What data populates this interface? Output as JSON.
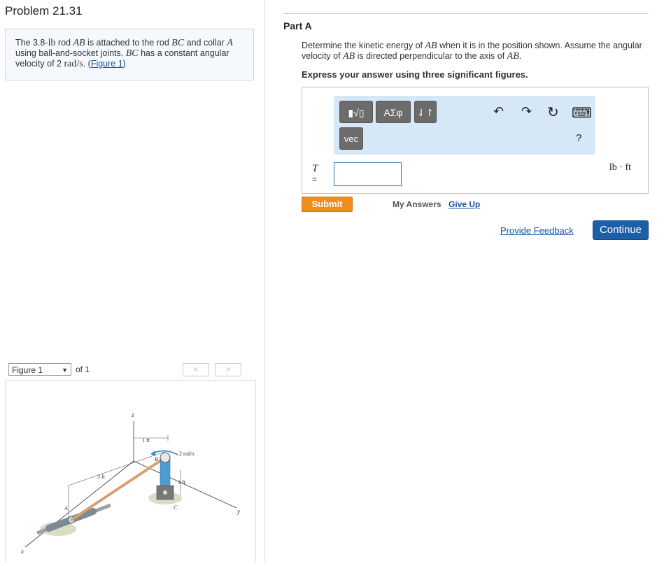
{
  "problem": {
    "title": "Problem 21.31",
    "text_1": "The 3.8-",
    "unit_lb": "lb",
    "text_2": " rod ",
    "rod_ab": "AB",
    "text_3": " is attached to the rod ",
    "rod_bc": "BC",
    "text_4": " and collar ",
    "collar_a": "A",
    "text_5": " using ball-and-socket joints. ",
    "rod_bc_2": "BC",
    "text_6": " has a constant angular velocity of 2 ",
    "unit_rads": "rad/s",
    "text_7": ". (",
    "figure_link": "Figure 1",
    "text_8": ")"
  },
  "figure_nav": {
    "select_value": "Figure 1",
    "of_text": "of 1",
    "prev": "<",
    "next": ">"
  },
  "figure": {
    "label_z": "z",
    "label_x": "x",
    "label_y": "y",
    "label_1ft_top": "1 ft",
    "label_rads": "2 rad/s",
    "label_B": "B",
    "label_3ft": "3 ft",
    "label_1ft_side": "1 ft",
    "label_A": "A",
    "label_C": "C"
  },
  "part": {
    "title": "Part A",
    "q_1": "Determine the kinetic energy of ",
    "q_ab": "AB",
    "q_2": " when it is in the position shown. Assume the angular velocity of ",
    "q_ab_2": "AB",
    "q_3": " is directed perpendicular to the axis of ",
    "q_ab_3": "AB",
    "q_4": ".",
    "instruction": "Express your answer using three significant figures."
  },
  "answer": {
    "tool_template": "▮√▯",
    "tool_greek": "ΑΣφ",
    "tool_arrows": "⇃↾",
    "tool_vec": "vec",
    "undo": "↶",
    "redo": "↷",
    "reset": "↻",
    "keyboard": "⌨",
    "help": "?",
    "variable": "T",
    "equals": "=",
    "value": "",
    "unit": "lb · ft"
  },
  "actions": {
    "submit": "Submit",
    "my_answers": "My Answers",
    "give_up": "Give Up",
    "feedback": "Provide Feedback",
    "continue": "Continue"
  },
  "colors": {
    "submit": "#f08c1c",
    "continue": "#1d5ea8",
    "toolbar": "#d6e8f8",
    "link": "#1a54a0"
  }
}
